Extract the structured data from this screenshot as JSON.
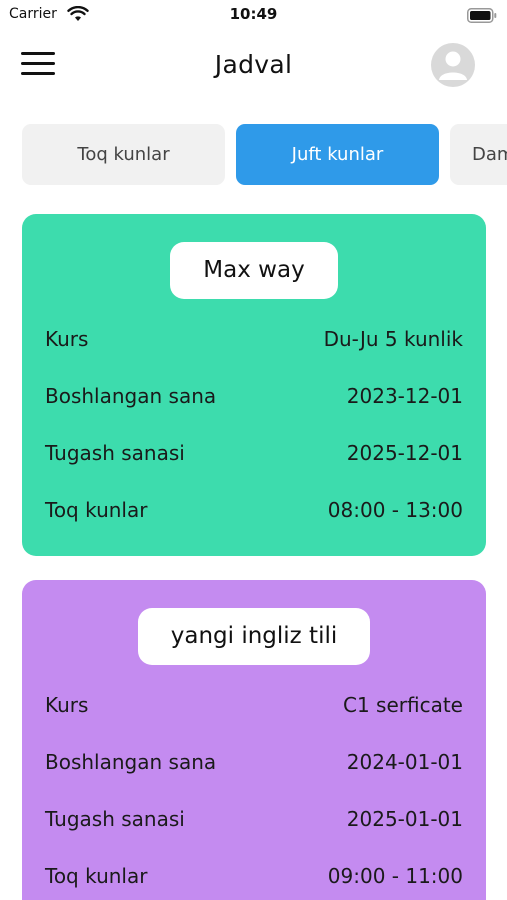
{
  "status_bar": {
    "carrier": "Carrier",
    "time": "10:49"
  },
  "header": {
    "title": "Jadval"
  },
  "tabs": [
    {
      "label": "Toq kunlar",
      "active": false
    },
    {
      "label": "Juft kunlar",
      "active": true
    },
    {
      "label": "Dam",
      "active": false
    }
  ],
  "cards": [
    {
      "title": "Max way",
      "color": "#3ddcad",
      "rows": [
        {
          "label": "Kurs",
          "value": "Du-Ju 5 kunlik"
        },
        {
          "label": "Boshlangan sana",
          "value": "2023-12-01"
        },
        {
          "label": "Tugash sanasi",
          "value": "2025-12-01"
        },
        {
          "label": "Toq kunlar",
          "value": "08:00 - 13:00"
        }
      ]
    },
    {
      "title": "yangi ingliz tili",
      "color": "#c48bf0",
      "rows": [
        {
          "label": "Kurs",
          "value": "C1 serficate"
        },
        {
          "label": "Boshlangan sana",
          "value": "2024-01-01"
        },
        {
          "label": "Tugash sanasi",
          "value": "2025-01-01"
        },
        {
          "label": "Toq kunlar",
          "value": "09:00 - 11:00"
        }
      ]
    }
  ],
  "colors": {
    "accent": "#2f9ae9",
    "tab_inactive": "#f1f1f1"
  }
}
